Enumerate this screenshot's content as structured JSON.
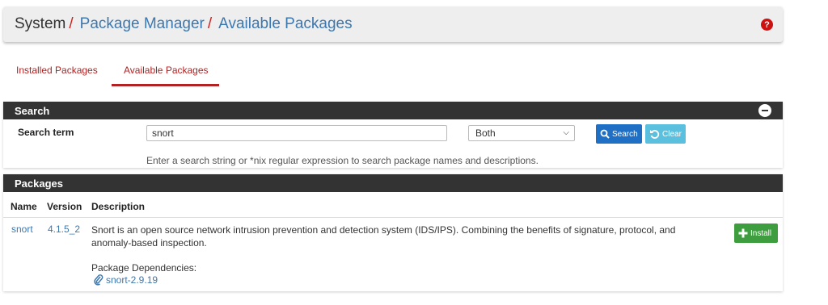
{
  "breadcrumb": {
    "system": "System",
    "separator": "/",
    "package_manager": "Package Manager",
    "available_packages": "Available Packages"
  },
  "help_icon": "?",
  "tabs": [
    {
      "label": "Installed Packages",
      "active": false
    },
    {
      "label": "Available Packages",
      "active": true
    }
  ],
  "search_panel": {
    "heading": "Search",
    "term_label": "Search term",
    "term_value": "snort",
    "scope_selected": "Both",
    "search_button": "Search",
    "clear_button": "Clear",
    "help_text": "Enter a search string or *nix regular expression to search package names and descriptions."
  },
  "packages_panel": {
    "heading": "Packages",
    "columns": [
      "Name",
      "Version",
      "Description"
    ],
    "rows": [
      {
        "name": "snort",
        "version": "4.1.5_2",
        "description": "Snort is an open source network intrusion prevention and detection system (IDS/IPS). Combining the benefits of signature, protocol, and anomaly-based inspection.",
        "dependencies_label": "Package Dependencies:",
        "dependency": "snort-2.9.19",
        "install_button": "Install"
      }
    ]
  },
  "colors": {
    "accent_red": "#b22222",
    "link_blue": "#3c78b0",
    "panel_heading": "#333333",
    "search_button": "#1f6fc5",
    "clear_button": "#5bc0de",
    "install_button": "#3e9d3e"
  },
  "icons": {
    "help": "question-circle-icon",
    "collapse": "minus-circle-icon",
    "search": "search-icon",
    "clear": "undo-icon",
    "install": "plus-icon",
    "dependency": "paperclip-icon",
    "select": "chevron-down-icon"
  }
}
